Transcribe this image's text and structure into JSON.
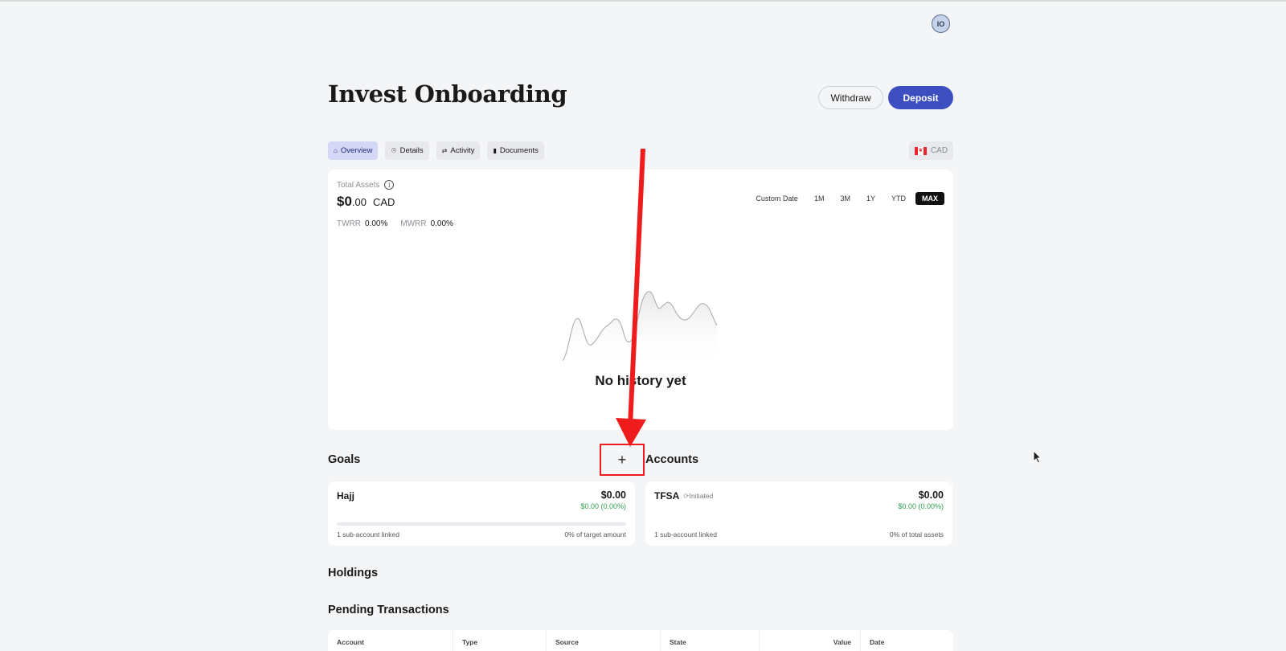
{
  "header": {
    "avatar_initials": "IO"
  },
  "page": {
    "title": "Invest Onboarding"
  },
  "actions": {
    "withdraw_label": "Withdraw",
    "deposit_label": "Deposit"
  },
  "tabs": [
    {
      "label": "Overview",
      "icon": "home-icon",
      "active": true
    },
    {
      "label": "Details",
      "icon": "person-icon",
      "active": false
    },
    {
      "label": "Activity",
      "icon": "swap-icon",
      "active": false
    },
    {
      "label": "Documents",
      "icon": "document-icon",
      "active": false
    }
  ],
  "currency": {
    "label": "CAD",
    "flag": "canada-flag-icon"
  },
  "total_assets": {
    "label": "Total Assets",
    "value_main": "$0",
    "value_cents": ".00",
    "currency": "CAD",
    "twrr_label": "TWRR",
    "twrr_value": "0.00%",
    "mwrr_label": "MWRR",
    "mwrr_value": "0.00%",
    "ranges": [
      "Custom Date",
      "1M",
      "3M",
      "1Y",
      "YTD",
      "MAX"
    ],
    "selected_range": "MAX",
    "empty_message": "No history yet"
  },
  "goals": {
    "title": "Goals",
    "add_label": "+",
    "items": [
      {
        "name": "Hajj",
        "amount": "$0.00",
        "change": "$0.00 (0.00%)",
        "progress": 0,
        "sub_accounts": "1 sub-account linked",
        "target": "0% of target amount"
      }
    ]
  },
  "accounts": {
    "title": "Accounts",
    "items": [
      {
        "name": "TFSA",
        "status": "Initiated",
        "amount": "$0.00",
        "change": "$0.00 (0.00%)",
        "sub_accounts": "1 sub-account linked",
        "share": "0% of total assets"
      }
    ]
  },
  "holdings": {
    "title": "Holdings"
  },
  "pending": {
    "title": "Pending Transactions",
    "columns": [
      "Account",
      "Type",
      "Source",
      "State",
      "Value",
      "Date"
    ]
  },
  "colors": {
    "accent": "#3d4fc0",
    "annotation": "#ee1c1c",
    "positive": "#2e9e4e",
    "background": "#f4f5f7"
  }
}
